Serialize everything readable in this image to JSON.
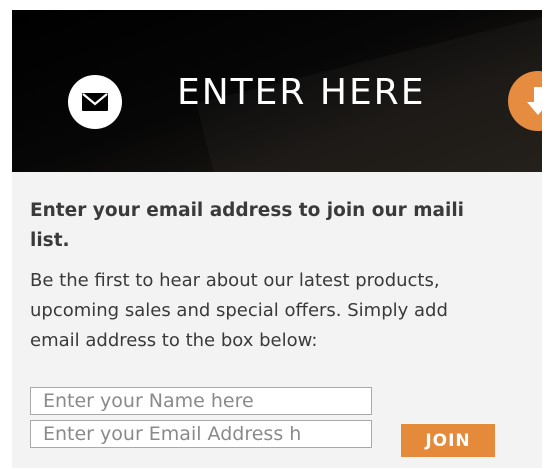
{
  "banner": {
    "title": "ENTER HERE",
    "left_icon": "envelope-icon",
    "right_icon": "arrow-down-icon",
    "accent_color": "#e5893a"
  },
  "content": {
    "headline_lines": [
      "Enter your email address to join our maili",
      "list."
    ],
    "description_lines": [
      "Be the first to hear about our latest products,",
      "upcoming sales and special offers. Simply add",
      "email address to the box below:"
    ]
  },
  "form": {
    "name_placeholder": "Enter your Name here",
    "email_placeholder": "Enter your Email Address h",
    "join_label": "JOIN"
  }
}
